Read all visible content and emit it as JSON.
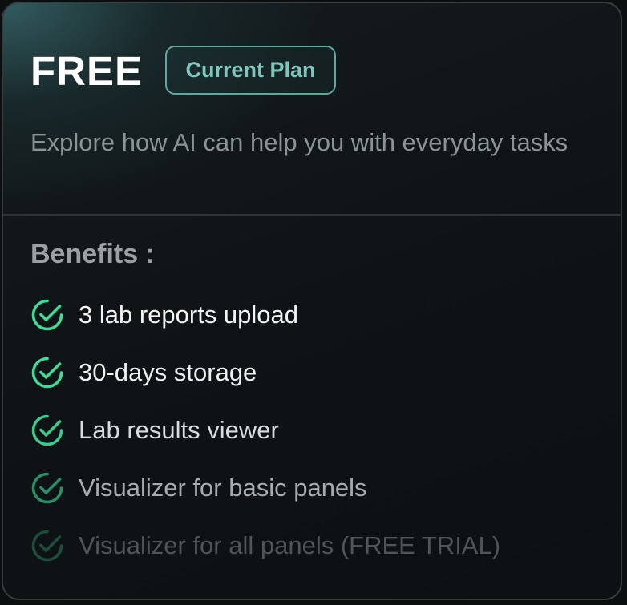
{
  "plan": {
    "name": "FREE",
    "badge": "Current Plan",
    "description": "Explore how AI can help you with everyday tasks"
  },
  "benefits": {
    "heading": "Benefits :",
    "items": [
      {
        "label": "3 lab reports upload"
      },
      {
        "label": "30-days storage"
      },
      {
        "label": "Lab results viewer"
      },
      {
        "label": "Visualizer for basic panels"
      },
      {
        "label": "Visualizer for all panels (FREE TRIAL)"
      }
    ]
  },
  "colors": {
    "accent": "#3ddc97",
    "badge_border": "#5fa7a0",
    "card_border": "#3a3d40"
  },
  "icons": {
    "benefit": "check-circle-icon"
  }
}
